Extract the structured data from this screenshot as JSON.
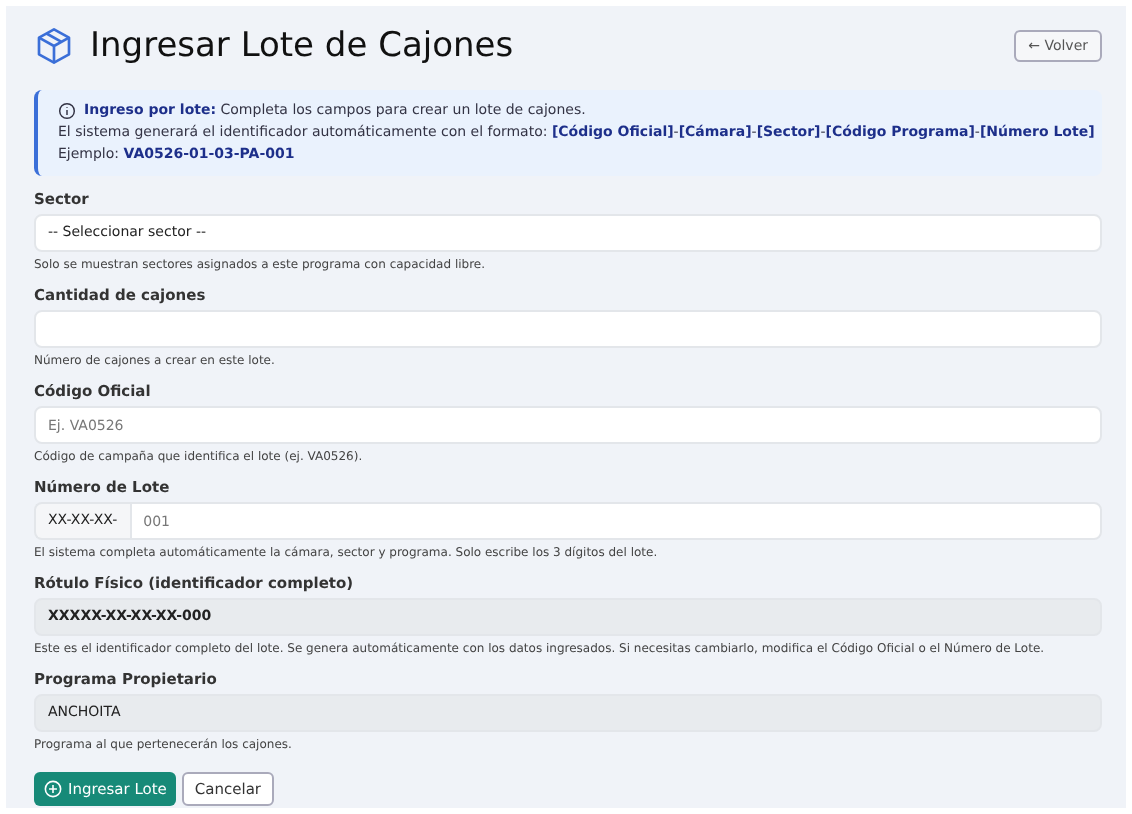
{
  "header": {
    "title": "Ingresar Lote de Cajones",
    "back_button": "← Volver"
  },
  "alert": {
    "lines": [
      "**Ingreso por lote:** Completa los campos para crear un lote de cajones.",
      "El sistema generará el identificador automáticamente con el formato: **[Código Oficial]**-**[Cámara]**-**[Sector]**-**[Código Programa]**-**[Número Lote]**",
      "Ejemplo: **VA0526-01-03-PA-001**"
    ]
  },
  "fields": [
    {
      "kind": "select",
      "label": "Sector",
      "value": "-- Seleccionar sector --",
      "help": "Solo se muestran sectores asignados a este programa con capacidad libre."
    },
    {
      "kind": "input",
      "label": "Cantidad de cajones",
      "help": "Número de cajones a crear en este lote."
    },
    {
      "kind": "input",
      "label": "Código Oficial",
      "placeholder": "Ej. VA0526",
      "help": "Código de campaña que identifica el lote (ej. VA0526)."
    },
    {
      "kind": "prefixed",
      "label": "Número de Lote",
      "prefix": "XX-XX-XX-",
      "placeholder": "001",
      "help": "El sistema completa automáticamente la cámara, sector y programa. Solo escribe los 3 dígitos del lote."
    },
    {
      "kind": "readonly",
      "label": "Rótulo Físico (identificador completo)",
      "value": "XXXXX-XX-XX-XX-000",
      "bold": true,
      "help": "Este es el identificador completo del lote. Se genera automáticamente con los datos ingresados. Si necesitas cambiarlo, modifica el Código Oficial o el Número de Lote."
    },
    {
      "kind": "readonly",
      "label": "Programa Propietario",
      "value": "ANCHOITA",
      "bold": false,
      "help": "Programa al que pertenecerán los cajones."
    }
  ],
  "buttons": {
    "submit": "Ingresar Lote",
    "cancel": "Cancelar"
  }
}
